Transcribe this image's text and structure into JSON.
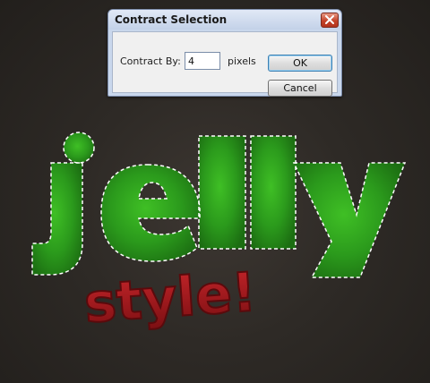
{
  "dialog": {
    "title": "Contract Selection",
    "contract_label": "Contract By:",
    "contract_value": "4",
    "unit": "pixels",
    "ok_label": "OK",
    "cancel_label": "Cancel"
  },
  "artwork": {
    "primary_word": "jelly",
    "secondary_word": "style!",
    "primary_color": "#2b9a1c",
    "secondary_color": "#a5151c",
    "background_color": "#2e2a26"
  },
  "icons": {
    "close": "close-icon"
  }
}
